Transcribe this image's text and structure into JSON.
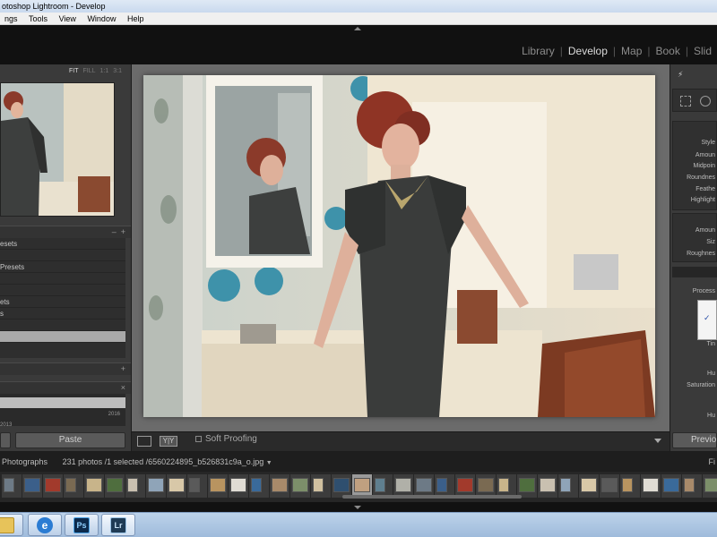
{
  "window": {
    "title": "otoshop Lightroom - Develop"
  },
  "menu": {
    "items": [
      "ngs",
      "Tools",
      "View",
      "Window",
      "Help"
    ]
  },
  "modules": {
    "items": [
      "Library",
      "Develop",
      "Map",
      "Book",
      "Slid"
    ],
    "active": "Develop"
  },
  "navigator": {
    "fit": "FIT",
    "fill": "FILL",
    "one": "1:1",
    "three": "3:1"
  },
  "presets": {
    "header_minus": "–",
    "header_plus": "+",
    "rows": [
      "esets",
      "",
      "Presets",
      "",
      "",
      "ets",
      "s"
    ]
  },
  "snapshots": {
    "plus": "+"
  },
  "history": {
    "close": "×",
    "year": "2016",
    "year2": "2013"
  },
  "buttons": {
    "copy": "",
    "paste": "Paste",
    "previous": "Previo"
  },
  "toolbar": {
    "soft_proofing": "Soft Proofing",
    "yy": "Y|Y"
  },
  "right_panel": {
    "labels": [
      "Style",
      "Amoun",
      "Midpoin",
      "Roundnes",
      "Feathe",
      "Highlight",
      "Amoun",
      "Siz",
      "Roughnes",
      "Process",
      "Tin",
      "Hu",
      "Saturation",
      "Hu"
    ],
    "check": "✓",
    "lightning": "⚡"
  },
  "filmstrip": {
    "source": "Photographs",
    "count": "231 photos /1 selected /",
    "filename": "6560224895_b526831c9a_o.jpg",
    "filter": "Fi"
  },
  "colors": {
    "accent": "#dcdcdc",
    "panel": "#3a3a3a",
    "taskbar": "#b3cae6"
  },
  "taskbar": {
    "ps_label": "Ps",
    "lr_label": "Lr"
  }
}
